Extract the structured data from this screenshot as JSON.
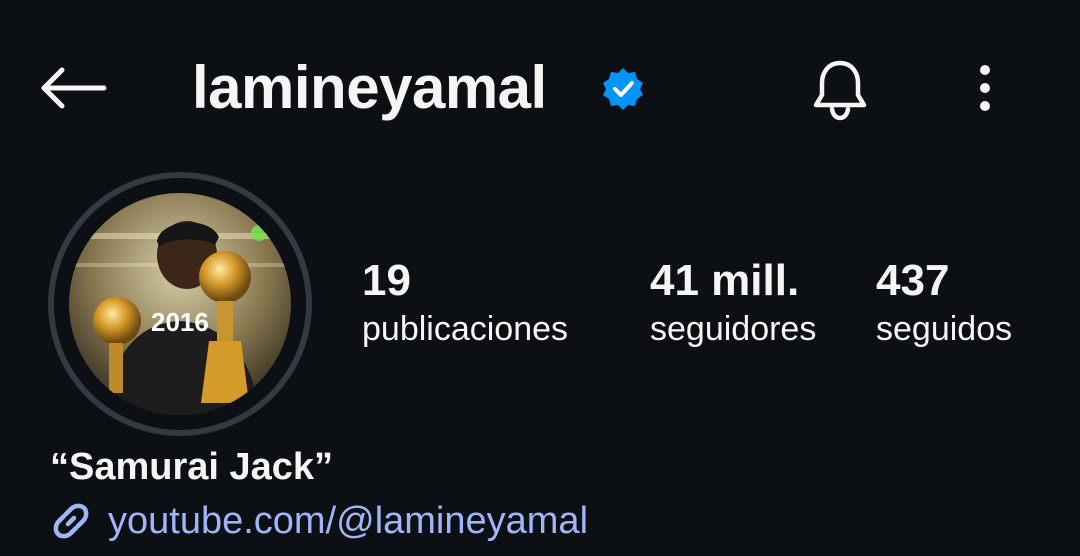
{
  "header": {
    "back_icon": "arrow-left-icon",
    "username": "lamineyamal",
    "verified_icon": "verified-badge-icon",
    "notifications_icon": "bell-icon",
    "more_icon": "more-vertical-icon"
  },
  "profile": {
    "avatar_icon": "profile-picture",
    "stats": {
      "posts": {
        "value": "19",
        "label": "publicaciones"
      },
      "followers": {
        "value": "41 mill.",
        "label": "seguidores"
      },
      "following": {
        "value": "437",
        "label": "seguidos"
      }
    },
    "display_name": "“Samurai Jack”",
    "link": {
      "icon": "link-icon",
      "text": "youtube.com/@lamineyamal"
    }
  },
  "colors": {
    "background": "#0c1014",
    "text": "#f5f5f5",
    "verified_blue": "#0095f6",
    "link": "#a0b4f8",
    "avatar_ring": "#363a40"
  }
}
